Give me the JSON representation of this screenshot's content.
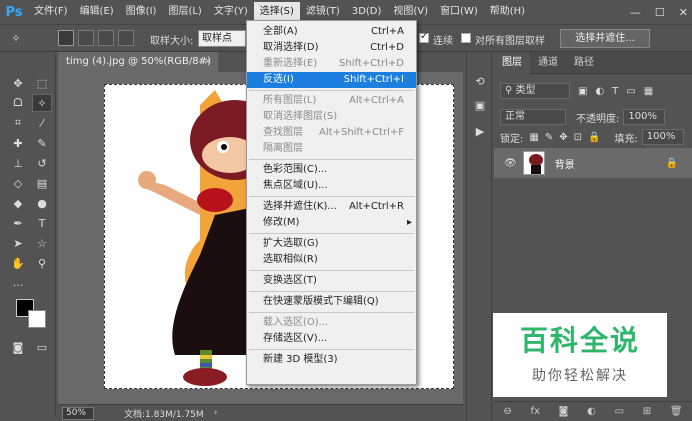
{
  "app": {
    "logo": "Ps"
  },
  "menubar": {
    "items": [
      "文件(F)",
      "编辑(E)",
      "图像(I)",
      "图层(L)",
      "文字(Y)",
      "选择(S)",
      "滤镜(T)",
      "3D(D)",
      "视图(V)",
      "窗口(W)",
      "帮助(H)"
    ],
    "active_index": 5
  },
  "window_controls": {
    "minimize": "—",
    "maximize": "☐",
    "close": "✕"
  },
  "options": {
    "sample_size_label": "取样大小:",
    "sample_size_value": "取样点",
    "contiguous_label": "连续",
    "contiguous_checked": true,
    "sample_all_layers_label": "对所有图层取样",
    "sample_all_layers_checked": false,
    "select_and_mask_button": "选择并遮住..."
  },
  "document": {
    "tab_title": "timg (4).jpg @ 50%(RGB/8#)",
    "close_glyph": "×",
    "zoom": "50%",
    "info": "文档:1.83M/1.75M",
    "status_arrow": "›"
  },
  "select_menu": [
    {
      "label": "全部(A)",
      "shortcut": "Ctrl+A",
      "disabled": false
    },
    {
      "label": "取消选择(D)",
      "shortcut": "Ctrl+D",
      "disabled": false
    },
    {
      "label": "重新选择(E)",
      "shortcut": "Shift+Ctrl+D",
      "disabled": true
    },
    {
      "label": "反选(I)",
      "shortcut": "Shift+Ctrl+I",
      "disabled": false,
      "highlighted": true
    },
    {
      "separator": true
    },
    {
      "label": "所有图层(L)",
      "shortcut": "Alt+Ctrl+A",
      "disabled": true
    },
    {
      "label": "取消选择图层(S)",
      "shortcut": "",
      "disabled": true
    },
    {
      "label": "查找图层",
      "shortcut": "Alt+Shift+Ctrl+F",
      "disabled": true
    },
    {
      "label": "隔离图层",
      "shortcut": "",
      "disabled": true
    },
    {
      "separator": true
    },
    {
      "label": "色彩范围(C)...",
      "shortcut": "",
      "disabled": false
    },
    {
      "label": "焦点区域(U)...",
      "shortcut": "",
      "disabled": false
    },
    {
      "separator": true
    },
    {
      "label": "选择并遮住(K)...",
      "shortcut": "Alt+Ctrl+R",
      "disabled": false
    },
    {
      "label": "修改(M)",
      "shortcut": "",
      "disabled": false,
      "submenu": true
    },
    {
      "separator": true
    },
    {
      "label": "扩大选取(G)",
      "shortcut": "",
      "disabled": false
    },
    {
      "label": "选取相似(R)",
      "shortcut": "",
      "disabled": false
    },
    {
      "separator": true
    },
    {
      "label": "变换选区(T)",
      "shortcut": "",
      "disabled": false
    },
    {
      "separator": true
    },
    {
      "label": "在快速蒙版模式下编辑(Q)",
      "shortcut": "",
      "disabled": false
    },
    {
      "separator": true
    },
    {
      "label": "载入选区(O)...",
      "shortcut": "",
      "disabled": true
    },
    {
      "label": "存储选区(V)...",
      "shortcut": "",
      "disabled": false
    },
    {
      "separator": true
    },
    {
      "label": "新建 3D 模型(3)",
      "shortcut": "",
      "disabled": false
    }
  ],
  "layers_panel": {
    "tabs": [
      "图层",
      "通道",
      "路径"
    ],
    "active_tab": 0,
    "filter_kind": "类型",
    "blend_mode": "正常",
    "opacity_label": "不透明度:",
    "opacity_value": "100%",
    "lock_label": "锁定:",
    "fill_label": "填充:",
    "fill_value": "100%",
    "layer_name": "背景"
  },
  "watermark": {
    "title": "百科全说",
    "subtitle": "助你轻松解决"
  },
  "colors": {
    "accent": "#1c7fe0",
    "watermark_green": "#2fb66b",
    "ps_blue": "#31a8ff"
  }
}
